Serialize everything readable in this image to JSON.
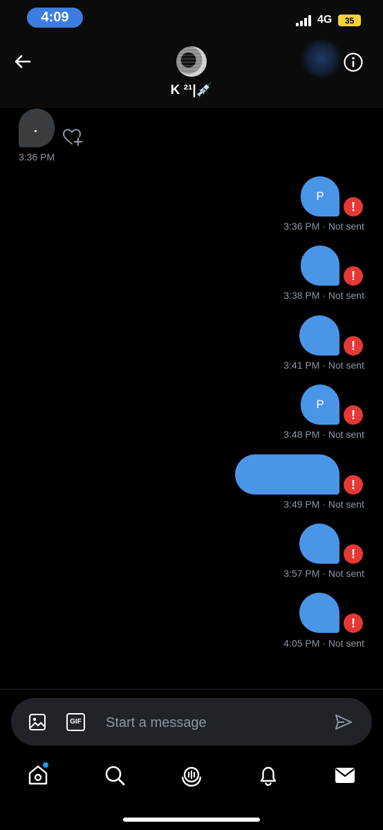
{
  "status_bar": {
    "time": "4:09",
    "network": "4G",
    "battery": "35",
    "icons": [
      "signal-icon",
      "battery-charging-icon"
    ]
  },
  "header": {
    "contact_name": "K ²¹|💉",
    "icons": [
      "back-arrow-icon",
      "info-icon"
    ]
  },
  "chat": {
    "received": {
      "time": "3:36 PM",
      "icons": [
        "heart-plus-icon"
      ]
    },
    "messages": [
      {
        "text": "P",
        "time": "3:36 PM",
        "status": "· Not sent"
      },
      {
        "text": "",
        "time": "3:38 PM",
        "status": "· Not sent"
      },
      {
        "text": "",
        "time": "3:41 PM",
        "status": "· Not sent"
      },
      {
        "text": "P",
        "time": "3:48 PM",
        "status": "· Not sent"
      },
      {
        "text": "",
        "time": "3:49 PM",
        "status": "· Not sent"
      },
      {
        "text": "",
        "time": "3:57 PM",
        "status": "· Not sent"
      },
      {
        "text": "",
        "time": "4:05 PM",
        "status": "· Not sent"
      }
    ],
    "error_glyph": "!"
  },
  "composer": {
    "placeholder": "Start a message",
    "gif_label": "GIF",
    "icons": [
      "image-icon",
      "gif-icon",
      "send-icon"
    ]
  },
  "tabbar": {
    "icons": [
      "home-icon",
      "search-icon",
      "spaces-icon",
      "notifications-icon",
      "messages-icon"
    ]
  },
  "colors": {
    "accent": "#1d9bf0",
    "bubble_sent": "#4b95e9",
    "bubble_received": "#3a3d40",
    "error": "#e53935",
    "muted_text": "#8b98a5",
    "time_pill": "#3b7de0",
    "battery": "#f3d23a"
  }
}
